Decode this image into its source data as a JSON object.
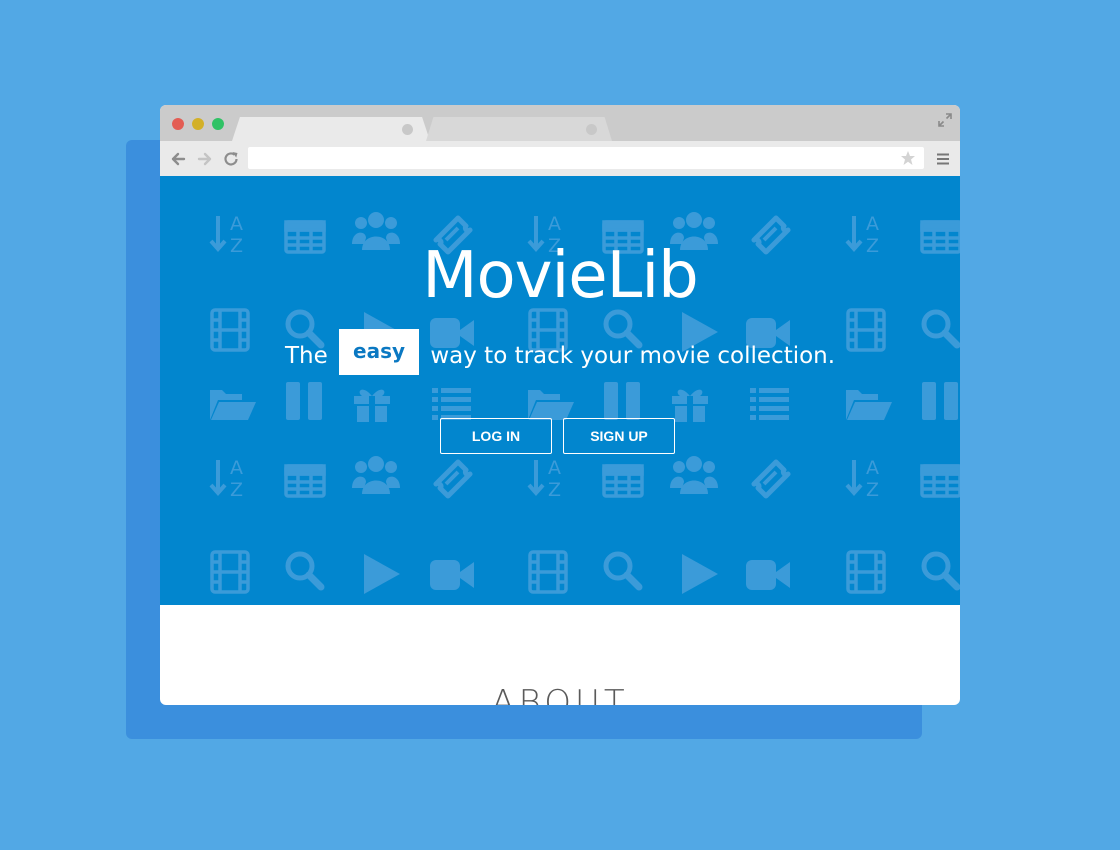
{
  "browser": {
    "tabs": [
      {
        "label": ""
      },
      {
        "label": ""
      }
    ],
    "url": ""
  },
  "hero": {
    "title": "MovieLib",
    "tagline_before": "The",
    "tagline_highlight": "easy",
    "tagline_after": "way to track your movie collection.",
    "login_label": "LOG IN",
    "signup_label": "SIGN UP"
  },
  "about": {
    "heading": "ABOUT"
  },
  "colors": {
    "page_background": "#52a8e5",
    "hero_background": "#0286ce",
    "accent_text": "#0a78c2"
  },
  "icons": {
    "pattern": [
      "sort-alpha-icon",
      "table-icon",
      "users-icon",
      "ticket-icon",
      "film-icon",
      "search-icon",
      "play-icon",
      "video-camera-icon",
      "folder-open-icon",
      "pause-icon",
      "gift-icon",
      "list-icon"
    ]
  }
}
